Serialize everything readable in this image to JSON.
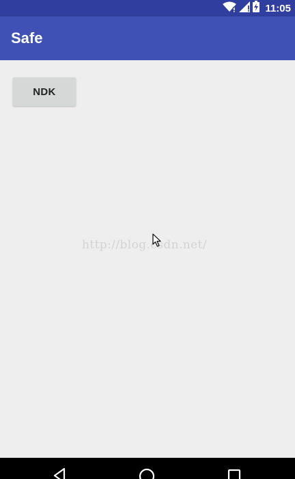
{
  "status_bar": {
    "time": "11:05",
    "icons": [
      "wifi-icon",
      "signal-icon",
      "battery-charging-icon"
    ]
  },
  "app_bar": {
    "title": "Safe"
  },
  "main": {
    "ndk_button_label": "NDK"
  },
  "watermark": "http://blog.csdn.net/",
  "nav_bar": {
    "icons": [
      "back-icon",
      "home-icon",
      "recents-icon"
    ]
  },
  "colors": {
    "status_bar": "#303f9f",
    "app_bar": "#3f51b5",
    "background": "#eeeeee",
    "button": "#d6d7d7",
    "nav_bar": "#000000"
  }
}
